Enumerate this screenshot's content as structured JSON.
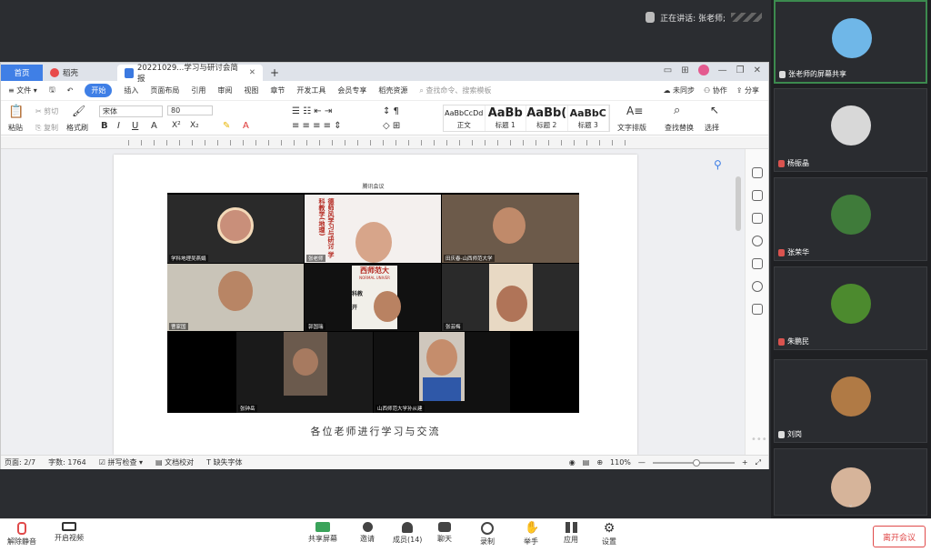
{
  "meeting": {
    "speaking_label": "正在讲话: 张老师;",
    "leave_button": "离开会议",
    "toolbar": {
      "mute": "解除静音",
      "video": "开启视频",
      "share": "共享屏幕",
      "invite": "邀请",
      "members": "成员(14)",
      "chat": "聊天",
      "record": "录制",
      "raise_hand": "举手",
      "apps": "应用",
      "settings": "设置"
    },
    "participants": [
      {
        "name": "张老师的屏幕共享",
        "avatar_color": "#6fb7e8",
        "muted": false
      },
      {
        "name": "杨振晶",
        "avatar_color": "#d8d8d8",
        "muted": true
      },
      {
        "name": "张荣华",
        "avatar_color": "#3f7b3a",
        "muted": true
      },
      {
        "name": "朱鹏民",
        "avatar_color": "#4c8a2e",
        "muted": true
      },
      {
        "name": "刘岗",
        "avatar_color": "#b07a45",
        "muted": false
      },
      {
        "name": "",
        "avatar_color": "#d6b49a",
        "muted": false
      }
    ]
  },
  "wps": {
    "tabs": {
      "home": "首页",
      "pdf": "稻壳",
      "doc": "20221029...学习与研讨会简报",
      "add": "+"
    },
    "menu": {
      "file": "文件",
      "items": [
        "开始",
        "插入",
        "页面布局",
        "引用",
        "审阅",
        "视图",
        "章节",
        "开发工具",
        "会员专享",
        "稻壳资源"
      ],
      "search": "查找命令、搜索模板",
      "sync": "未同步",
      "collab": "协作",
      "share": "分享"
    },
    "ribbon": {
      "paste": "粘贴",
      "cut": "剪切",
      "copy": "复制",
      "format_painter": "格式刷",
      "font": "宋体",
      "size": "80",
      "text_layout": "文字排版",
      "find_replace": "查找替换",
      "select": "选择",
      "styles": [
        {
          "sample": "AaBbCcDd",
          "name": "正文"
        },
        {
          "sample": "AaBb",
          "name": "标题 1"
        },
        {
          "sample": "AaBb(",
          "name": "标题 2"
        },
        {
          "sample": "AaBbC",
          "name": "标题 3"
        }
      ]
    },
    "status": {
      "page": "页面: 2/7",
      "words": "字数: 1764",
      "spell": "拼写检查",
      "proof": "文档校对",
      "missing_font": "缺失字体",
      "zoom": "110%"
    },
    "document": {
      "caption": "各位老师进行学习与交流",
      "embedded": {
        "window_title": "腾讯会议",
        "tiles": [
          {
            "label": "学科地理吴燕娟"
          },
          {
            "label": "张老师"
          },
          {
            "label": "田庆春-山西师范大学"
          },
          {
            "label": "曹家国"
          },
          {
            "label": "郭国瑞"
          },
          {
            "label": "张芸梅"
          },
          {
            "label": "张钟岳"
          },
          {
            "label": "山西师范大学孙从建"
          }
        ],
        "slide_text": [
          "西师范大",
          "NORMAL UNIVER",
          "科教",
          "开"
        ],
        "banner_text": "德师风学习与研讨 学科教学(地理)"
      }
    }
  }
}
